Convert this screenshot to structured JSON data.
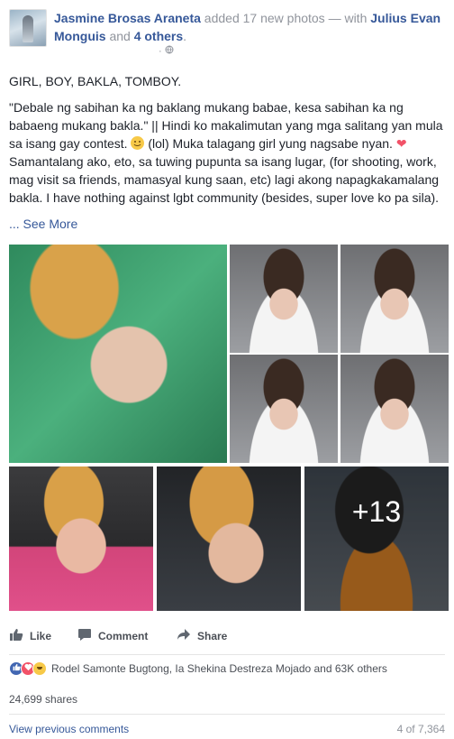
{
  "header": {
    "author": "Jasmine Brosas Araneta",
    "action": "added 17 new photos — with",
    "tagged_person": "Julius Evan Monguis",
    "and_text": "and",
    "others": "4 others",
    "time_separator": "·",
    "privacy_icon": "globe-icon"
  },
  "post": {
    "line1": "GIRL, BOY, BAKLA, TOMBOY.",
    "para2_a": "\"Debale ng sabihan ka ng baklang mukang babae, kesa sabihan ka ng babaeng mukang bakla.\" || Hindi ko makalimutan yang mga salitang yan mula sa isang gay contest.",
    "para2_b": "(lol) Muka talagang girl yung nagsabe nyan.",
    "heart": "❤",
    "para2_c": "Samantalang ako, eto, sa tuwing pupunta sa isang lugar, (for shooting, work, mag visit sa friends, mamasyal kung saan, etc) lagi akong napagkakamalang bakla. I have nothing against lgbt community (besides, super love ko pa sila).",
    "see_more": "... See More"
  },
  "photos": {
    "more_count": "+13"
  },
  "actions": {
    "like": "Like",
    "comment": "Comment",
    "share": "Share"
  },
  "reactions": {
    "text": "Rodel Samonte Bugtong, Ia Shekina Destreza Mojado and 63K others",
    "colors": {
      "like": "#4267b2",
      "love": "#f25268",
      "haha": "#f7c948"
    }
  },
  "shares": "24,699 shares",
  "comments": {
    "view_previous": "View previous comments",
    "count": "4 of 7,364"
  }
}
